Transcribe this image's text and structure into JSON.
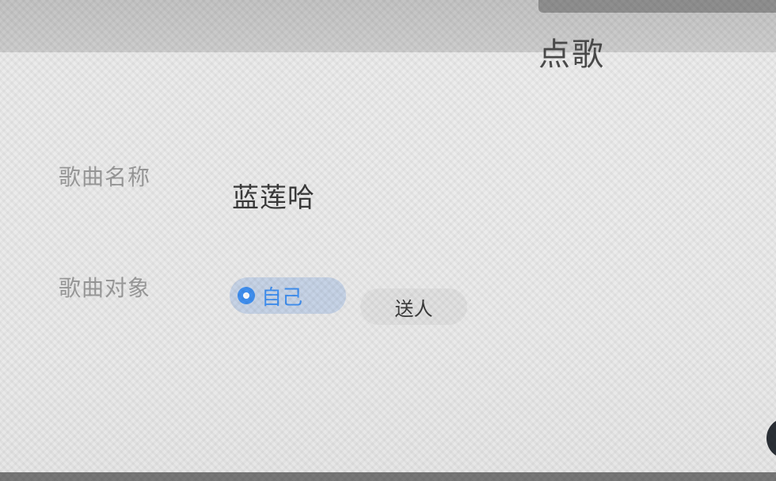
{
  "dialog": {
    "title": "点歌"
  },
  "form": {
    "song_name_label": "歌曲名称",
    "song_name_value": "蓝莲哈",
    "target_label": "歌曲对象",
    "options": [
      {
        "label": "自己",
        "selected": true
      },
      {
        "label": "送人",
        "selected": false
      }
    ]
  },
  "colors": {
    "accent": "#3f8ff0",
    "selected_bg": "#c6d3e6",
    "unselected_bg": "#e1e1e1",
    "label_text": "#9a9a9a",
    "value_text": "#3a3a3a"
  }
}
